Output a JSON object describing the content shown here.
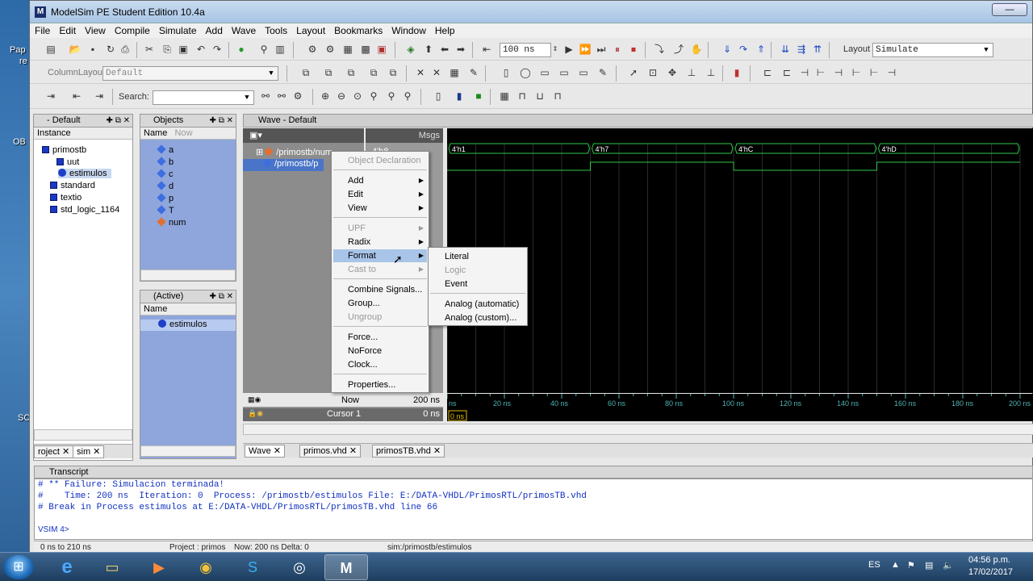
{
  "desktop": {
    "labels": [
      "Pap",
      "re",
      "OB",
      "SC"
    ]
  },
  "window": {
    "title": "ModelSim PE Student Edition 10.4a",
    "app_icon": "M",
    "min_label": "—"
  },
  "menu": [
    "File",
    "Edit",
    "View",
    "Compile",
    "Simulate",
    "Add",
    "Wave",
    "Tools",
    "Layout",
    "Bookmarks",
    "Window",
    "Help"
  ],
  "toolbar1": {
    "run_length": "100 ns",
    "layout_label": "Layout",
    "layout_value": "Simulate"
  },
  "toolbar2": {
    "column_layout_label": "ColumnLayout",
    "column_layout_value": "Default"
  },
  "toolbar3": {
    "search_label": "Search:"
  },
  "sim_panel": {
    "title": "- Default",
    "column": "Instance",
    "items": [
      {
        "name": "primostb",
        "type": "sq"
      },
      {
        "name": "uut",
        "type": "sq"
      },
      {
        "name": "estimulos",
        "type": "circ"
      },
      {
        "name": "standard",
        "type": "sq"
      },
      {
        "name": "textio",
        "type": "sq"
      },
      {
        "name": "std_logic_1164",
        "type": "sq"
      }
    ],
    "tabs": [
      "roject",
      "sim"
    ]
  },
  "objects_panel": {
    "title": "Objects",
    "col_name": "Name",
    "col_now": "Now",
    "items": [
      "a",
      "b",
      "c",
      "d",
      "p",
      "T",
      "num"
    ]
  },
  "active_panel": {
    "title": "(Active)",
    "col_name": "Name",
    "items": [
      "estimulos"
    ]
  },
  "wave": {
    "title": "Wave - Default",
    "msgs_label": "Msgs",
    "signals": [
      {
        "name": "/primostb/num",
        "value": "4'h8"
      },
      {
        "name": "/primostb/p",
        "value": ""
      }
    ],
    "now_label": "Now",
    "now_value": "200 ns",
    "cursor_label": "Cursor 1",
    "cursor_value": "0 ns",
    "cursor_marker": "0 ns",
    "bus_values": [
      "4'h1",
      "4'h7",
      "4'hC",
      "4'hD"
    ],
    "axis_labels": [
      "ns",
      "20 ns",
      "40 ns",
      "60 ns",
      "80 ns",
      "100 ns",
      "120 ns",
      "140 ns",
      "160 ns",
      "180 ns",
      "200 ns"
    ],
    "tabs": [
      "Wave",
      "primos.vhd",
      "primosTB.vhd"
    ]
  },
  "context_menu": {
    "items": [
      {
        "label": "Object Declaration",
        "disabled": true,
        "sub": false
      },
      {
        "label": "Add",
        "disabled": false,
        "sub": true
      },
      {
        "label": "Edit",
        "disabled": false,
        "sub": true
      },
      {
        "label": "View",
        "disabled": false,
        "sub": true
      },
      {
        "label": "UPF",
        "disabled": true,
        "sub": true
      },
      {
        "label": "Radix",
        "disabled": false,
        "sub": true
      },
      {
        "label": "Format",
        "disabled": false,
        "sub": true
      },
      {
        "label": "Cast to",
        "disabled": true,
        "sub": true
      },
      {
        "label": "Combine Signals...",
        "disabled": false,
        "sub": false
      },
      {
        "label": "Group...",
        "disabled": false,
        "sub": false
      },
      {
        "label": "Ungroup",
        "disabled": true,
        "sub": false
      },
      {
        "label": "Force...",
        "disabled": false,
        "sub": false
      },
      {
        "label": "NoForce",
        "disabled": false,
        "sub": false
      },
      {
        "label": "Clock...",
        "disabled": false,
        "sub": false
      },
      {
        "label": "Properties...",
        "disabled": false,
        "sub": false
      }
    ]
  },
  "format_submenu": {
    "items": [
      {
        "label": "Literal",
        "disabled": false
      },
      {
        "label": "Logic",
        "disabled": true
      },
      {
        "label": "Event",
        "disabled": false
      },
      {
        "label": "Analog (automatic)",
        "disabled": false
      },
      {
        "label": "Analog (custom)...",
        "disabled": false
      }
    ]
  },
  "transcript": {
    "title": "Transcript",
    "lines": [
      "# ** Failure: Simulacion terminada!",
      "#    Time: 200 ns  Iteration: 0  Process: /primostb/estimulos File: E:/DATA-VHDL/PrimosRTL/primosTB.vhd",
      "# Break in Process estimulos at E:/DATA-VHDL/PrimosRTL/primosTB.vhd line 66",
      "",
      "VSIM 4>"
    ]
  },
  "statusbar": {
    "range": "0 ns to 210 ns",
    "project": "Project : primos",
    "now": "Now: 200 ns  Delta: 0",
    "context": "sim:/primostb/estimulos"
  },
  "taskbar": {
    "lang": "ES",
    "time": "04:56 p.m.",
    "date": "17/02/2017",
    "apps": [
      "e",
      "folder",
      "media",
      "chrome",
      "skype",
      "obs",
      "modelsim"
    ]
  }
}
